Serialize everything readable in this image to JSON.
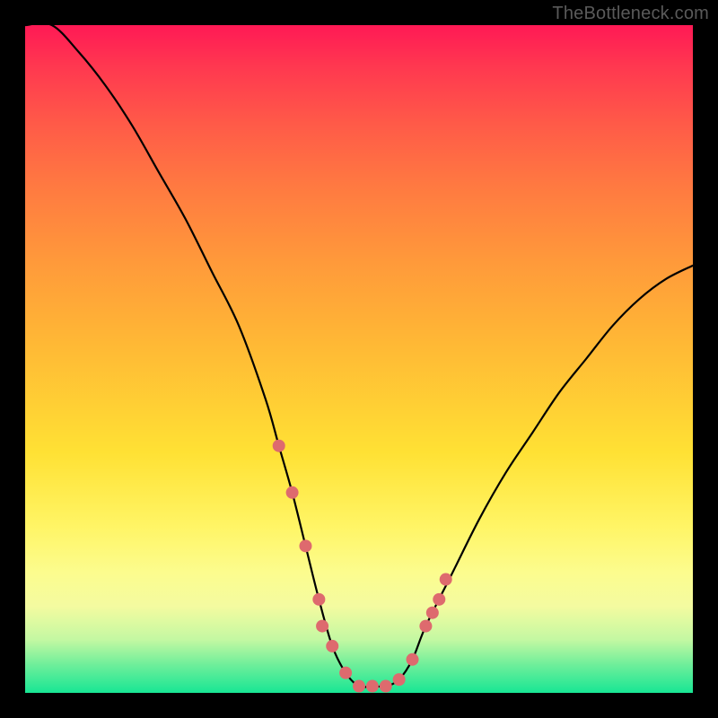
{
  "watermark": "TheBottleneck.com",
  "colors": {
    "curve_stroke": "#000000",
    "marker_fill": "#de6a6e",
    "frame_bg": "#000000"
  },
  "chart_data": {
    "type": "line",
    "title": "",
    "xlabel": "",
    "ylabel": "",
    "xlim": [
      0,
      100
    ],
    "ylim": [
      0,
      100
    ],
    "series": [
      {
        "name": "bottleneck-curve",
        "x": [
          0,
          4,
          8,
          12,
          16,
          20,
          24,
          28,
          32,
          36,
          38,
          40,
          42,
          44,
          46,
          48,
          50,
          52,
          54,
          56,
          58,
          60,
          64,
          68,
          72,
          76,
          80,
          84,
          88,
          92,
          96,
          100
        ],
        "values": [
          100,
          100,
          96,
          91,
          85,
          78,
          71,
          63,
          55,
          44,
          37,
          30,
          22,
          14,
          7,
          3,
          1,
          1,
          1,
          2,
          5,
          10,
          18,
          26,
          33,
          39,
          45,
          50,
          55,
          59,
          62,
          64
        ]
      }
    ],
    "markers": {
      "name": "highlight-dots",
      "x": [
        38,
        40,
        42,
        44,
        44.5,
        46,
        48,
        50,
        52,
        54,
        56,
        58,
        60,
        61,
        62,
        63
      ],
      "values": [
        37,
        30,
        22,
        14,
        10,
        7,
        3,
        1,
        1,
        1,
        2,
        5,
        10,
        12,
        14,
        17
      ]
    }
  }
}
